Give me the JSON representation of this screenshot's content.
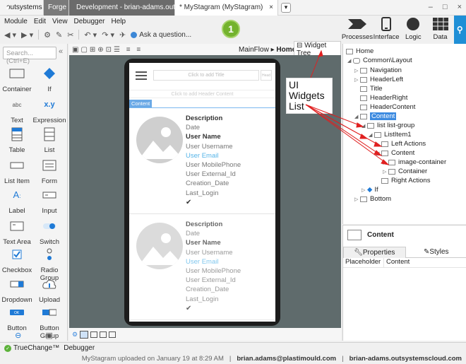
{
  "titlebar": {
    "app_name": "outsystems",
    "tabs": [
      "Forge",
      "Development - brian-adams.outs...",
      "* MyStagram (MyStagram)"
    ],
    "close_tab": "×",
    "add_tab": "▾",
    "win_minimize": "–",
    "win_maximize": "□",
    "win_close": "×"
  },
  "menu": [
    "Module",
    "Edit",
    "View",
    "Debugger",
    "Help"
  ],
  "toolbar": {
    "ask": "Ask a question...",
    "step": "1"
  },
  "bigtools": [
    "Processes",
    "Interface",
    "Logic",
    "Data"
  ],
  "sidebar": {
    "search_placeholder": "Search... (Ctrl+E)",
    "widgets": [
      "Container",
      "If",
      "Text",
      "Expression",
      "Table",
      "List",
      "List Item",
      "Form",
      "Label",
      "Input",
      "Text Area",
      "Switch",
      "Checkbox",
      "Radio Group",
      "Dropdown",
      "Upload",
      "Button",
      "Button Group"
    ]
  },
  "canvas": {
    "breadcrumb_flow": "MainFlow",
    "breadcrumb_sep": "▸",
    "breadcrumb_screen": "Home",
    "widget_tree": "Widget Tree",
    "title_placeholder": "Click to add Title",
    "header_placeholder": "Head",
    "header_content_placeholder": "Click to add Header Content",
    "content_tag": "Content",
    "card_fields": [
      "Description",
      "Date",
      "User Name",
      "User Username",
      "User Email",
      "User MobilePhone",
      "User External_Id",
      "Creation_Date",
      "Last_Login"
    ],
    "check": "✔"
  },
  "annotation": "UI Widgets List",
  "tree": {
    "nodes": [
      "Home",
      "Common\\Layout",
      "Navigation",
      "HeaderLeft",
      "Title",
      "HeaderRight",
      "HeaderContent",
      "Content",
      "list list-group",
      "ListItem1",
      "Left Actions",
      "Content",
      "image-container",
      "Container",
      "Right Actions",
      "If",
      "Bottom"
    ]
  },
  "properties": {
    "selected": "Content",
    "tab_properties": "Properties",
    "tab_styles": "Styles",
    "row_label": "Placeholder",
    "row_value": "Content"
  },
  "bottom_tabs": [
    "TrueChange™",
    "Debugger"
  ],
  "status": {
    "message": "MyStagram uploaded on January 19 at 8:29 AM",
    "user": "brian.adams@plastimould.com",
    "server": "brian-adams.outsystemscloud.com"
  },
  "colors": {
    "accent": "#3d8be0",
    "link": "#55b4e8",
    "step_green": "#74b32e",
    "annotation_arrow": "#e02020"
  }
}
